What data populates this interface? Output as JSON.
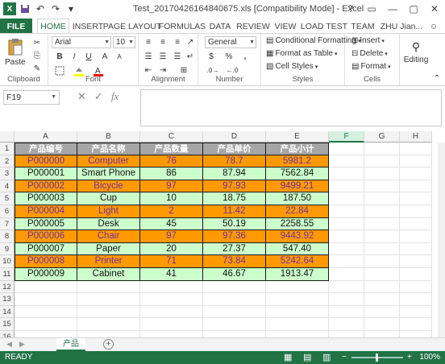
{
  "title": "Test_20170426164840675.xls  [Compatibility Mode] - Excel",
  "qat": {
    "save_icon": "save-icon",
    "undo_icon": "undo-icon",
    "redo_icon": "redo-icon"
  },
  "window_buttons": [
    "?",
    "▭",
    "—",
    "▢",
    "✕"
  ],
  "tabs": [
    "FILE",
    "HOME",
    "INSERT",
    "PAGE LAYOUT",
    "FORMULAS",
    "DATA",
    "REVIEW",
    "VIEW",
    "LOAD TEST",
    "TEAM"
  ],
  "user": "ZHU Jian...",
  "ribbon": {
    "clipboard": {
      "paste": "Paste",
      "label": "Clipboard"
    },
    "font": {
      "name": "Arial",
      "size": "10",
      "bold": "B",
      "italic": "I",
      "underline": "U",
      "grow": "A",
      "shrink": "A",
      "label": "Font"
    },
    "alignment": {
      "label": "Alignment"
    },
    "number": {
      "format": "General",
      "currency": "$",
      "percent": "%",
      "comma": ",",
      "label": "Number"
    },
    "styles": {
      "conditional": "Conditional Formatting",
      "table": "Format as Table",
      "cell": "Cell Styles",
      "label": "Styles"
    },
    "cells": {
      "insert": "Insert",
      "delete": "Delete",
      "format": "Format",
      "label": "Cells"
    },
    "editing": {
      "label": "Editing"
    }
  },
  "formula_bar": {
    "name_box": "F19",
    "formula": ""
  },
  "columns": [
    "A",
    "B",
    "C",
    "D",
    "E",
    "F",
    "G",
    "H"
  ],
  "rows": [
    "1",
    "2",
    "3",
    "4",
    "5",
    "6",
    "7",
    "8",
    "9",
    "10",
    "11",
    "12",
    "13",
    "14",
    "15",
    "16"
  ],
  "table": {
    "headers": [
      "产品编号",
      "产品名称",
      "产品数量",
      "产品单价",
      "产品小计"
    ],
    "rows": [
      [
        "P000000",
        "Computer",
        "76",
        "78.7",
        "5981.2"
      ],
      [
        "P000001",
        "Smart Phone",
        "86",
        "87.94",
        "7562.84"
      ],
      [
        "P000002",
        "Bicycle",
        "97",
        "97.93",
        "9499.21"
      ],
      [
        "P000003",
        "Cup",
        "10",
        "18.75",
        "187.50"
      ],
      [
        "P000004",
        "Light",
        "2",
        "11.42",
        "22.84"
      ],
      [
        "P000005",
        "Desk",
        "45",
        "50.19",
        "2258.55"
      ],
      [
        "P000006",
        "Chair",
        "97",
        "97.36",
        "9443.92"
      ],
      [
        "P000007",
        "Paper",
        "20",
        "27.37",
        "547.40"
      ],
      [
        "P000008",
        "Printer",
        "71",
        "73.84",
        "5242.64"
      ],
      [
        "P000009",
        "Cabinet",
        "41",
        "46.67",
        "1913.47"
      ]
    ]
  },
  "sheet_tab": "产品",
  "status": {
    "text": "READY",
    "zoom": "100%"
  },
  "colors": {
    "accent": "#217346",
    "orange_row": "#ff9900",
    "green_row": "#ccffcc",
    "header": "#a6a6a6",
    "orange_text": "#7030a0"
  }
}
